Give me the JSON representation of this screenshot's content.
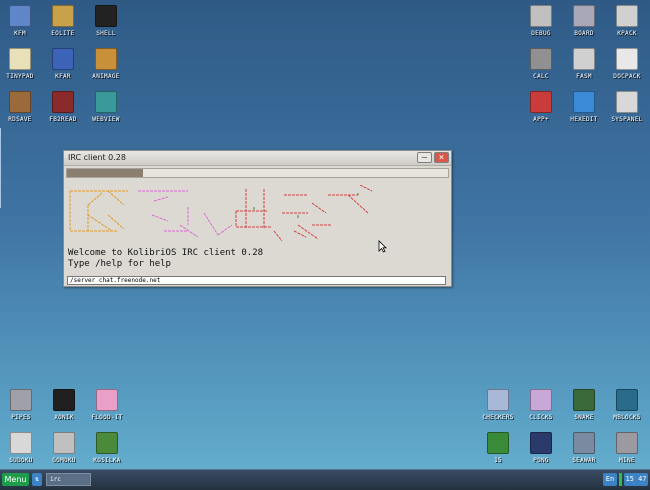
{
  "desktop": {
    "left_icons": [
      {
        "label": "KFM",
        "icon": "floppy-disk-icon",
        "color": "#5f86c8"
      },
      {
        "label": "EOLITE",
        "icon": "folder-icon",
        "color": "#c8a24a"
      },
      {
        "label": "SHELL",
        "icon": "terminal-icon",
        "color": "#222222"
      },
      {
        "label": "TINYPAD",
        "icon": "notepad-icon",
        "color": "#e8e0b8"
      },
      {
        "label": "KFAR",
        "icon": "kfar-icon",
        "color": "#3c63b8"
      },
      {
        "label": "ANIMAGE",
        "icon": "paint-tools-icon",
        "color": "#c9903a"
      },
      {
        "label": "RDSAVE",
        "icon": "disk-stack-icon",
        "color": "#9a6a3a"
      },
      {
        "label": "FB2READ",
        "icon": "book-reader-icon",
        "color": "#8a2a2a"
      },
      {
        "label": "WEBVIEW",
        "icon": "web-browser-icon",
        "color": "#3a9a9a"
      }
    ],
    "right_icons": [
      {
        "label": "DEBUG",
        "icon": "bug-icon",
        "color": "#c0c0c0"
      },
      {
        "label": "BOARD",
        "icon": "board-icon",
        "color": "#a8a8b8"
      },
      {
        "label": "KPACK",
        "icon": "package-arrow-icon",
        "color": "#d0d0d0"
      },
      {
        "label": "CALC",
        "icon": "calculator-icon",
        "color": "#909090"
      },
      {
        "label": "FASM",
        "icon": "assembler-icon",
        "color": "#d0d0d0"
      },
      {
        "label": "DOCPACK",
        "icon": "docs-icon",
        "color": "#e8e8e8"
      },
      {
        "label": "APP+",
        "icon": "cube-icon",
        "color": "#c83c3c"
      },
      {
        "label": "HEXEDIT",
        "icon": "hex-editor-icon",
        "color": "#3a8ad8"
      },
      {
        "label": "SYSPANEL",
        "icon": "sliders-icon",
        "color": "#d8d8d8"
      }
    ],
    "bottom_left_icons": [
      {
        "label": "PIPES",
        "icon": "pipes-icon",
        "color": "#a0a0a8"
      },
      {
        "label": "XONIK",
        "icon": "xonix-icon",
        "color": "#202020"
      },
      {
        "label": "FLOOD-IT",
        "icon": "flood-grid-icon",
        "color": "#e8a0c8"
      },
      {
        "label": "SUDOKU",
        "icon": "sudoku-icon",
        "color": "#d8d8d8"
      },
      {
        "label": "GOMOKU",
        "icon": "gomoku-icon",
        "color": "#c0c0c0"
      },
      {
        "label": "KOSILKA",
        "icon": "lawnmower-icon",
        "color": "#4a8a3a"
      }
    ],
    "bottom_right_icons": [
      {
        "label": "CHECKERS",
        "icon": "checkers-icon",
        "color": "#a8b8d8"
      },
      {
        "label": "CLICKS",
        "icon": "blocks-icon",
        "color": "#c8a8d8"
      },
      {
        "label": "SNAKE",
        "icon": "snake-icon",
        "color": "#3a6a3a"
      },
      {
        "label": "MBLOCKS",
        "icon": "mblocks-icon",
        "color": "#2a6a8a"
      },
      {
        "label": "15",
        "icon": "fifteen-puzzle-icon",
        "color": "#3a8a3a"
      },
      {
        "label": "PONG",
        "icon": "pong-icon",
        "color": "#2a3a6a"
      },
      {
        "label": "SEAWAR",
        "icon": "sea-battle-icon",
        "color": "#7a8aa0"
      },
      {
        "label": "MINE",
        "icon": "mine-icon",
        "color": "#9a9aa0"
      }
    ]
  },
  "irc_window": {
    "title": "IRC client 0.28",
    "minimize_label": "–",
    "close_label": "×",
    "ascii_logo_colors": [
      "#e39a2a",
      "#d96ad2",
      "#d24343",
      "#3e8f2e"
    ],
    "welcome_line": "Welcome to KolibriOS IRC client 0.28",
    "help_line": "Type /help for help",
    "command_input_value": "/server chat.freenode.net"
  },
  "taskbar": {
    "menu_label": "Menu",
    "arrow_label": "⇅",
    "running_task": "irc",
    "language": "En",
    "clock": "15 47",
    "accent": "#1e9c4a"
  }
}
